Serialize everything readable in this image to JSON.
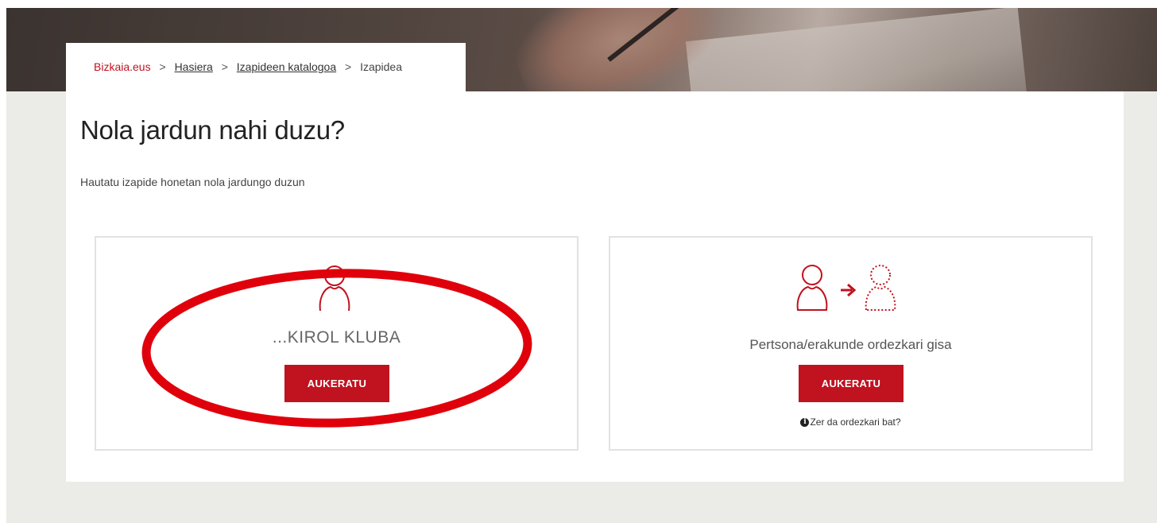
{
  "breadcrumb": {
    "home": "Bizkaia.eus",
    "separator": ">",
    "items": [
      "Hasiera",
      "Izapideen katalogoa"
    ],
    "current": "Izapidea"
  },
  "page": {
    "title": "Nola jardun nahi duzu?",
    "subtitle": "Hautatu izapide honetan nola jardungo duzun"
  },
  "options": [
    {
      "label": "...KIROL KLUBA",
      "button_label": "AUKERATU",
      "icon": "person-icon"
    },
    {
      "label": "Pertsona/erakunde ordezkari gisa",
      "button_label": "AUKERATU",
      "icon": "representative-icon",
      "help_link": "Zer da ordezkari bat?"
    }
  ],
  "colors": {
    "accent": "#c1121f",
    "page_background": "#ebebe7",
    "annotation": "#e0000b"
  }
}
